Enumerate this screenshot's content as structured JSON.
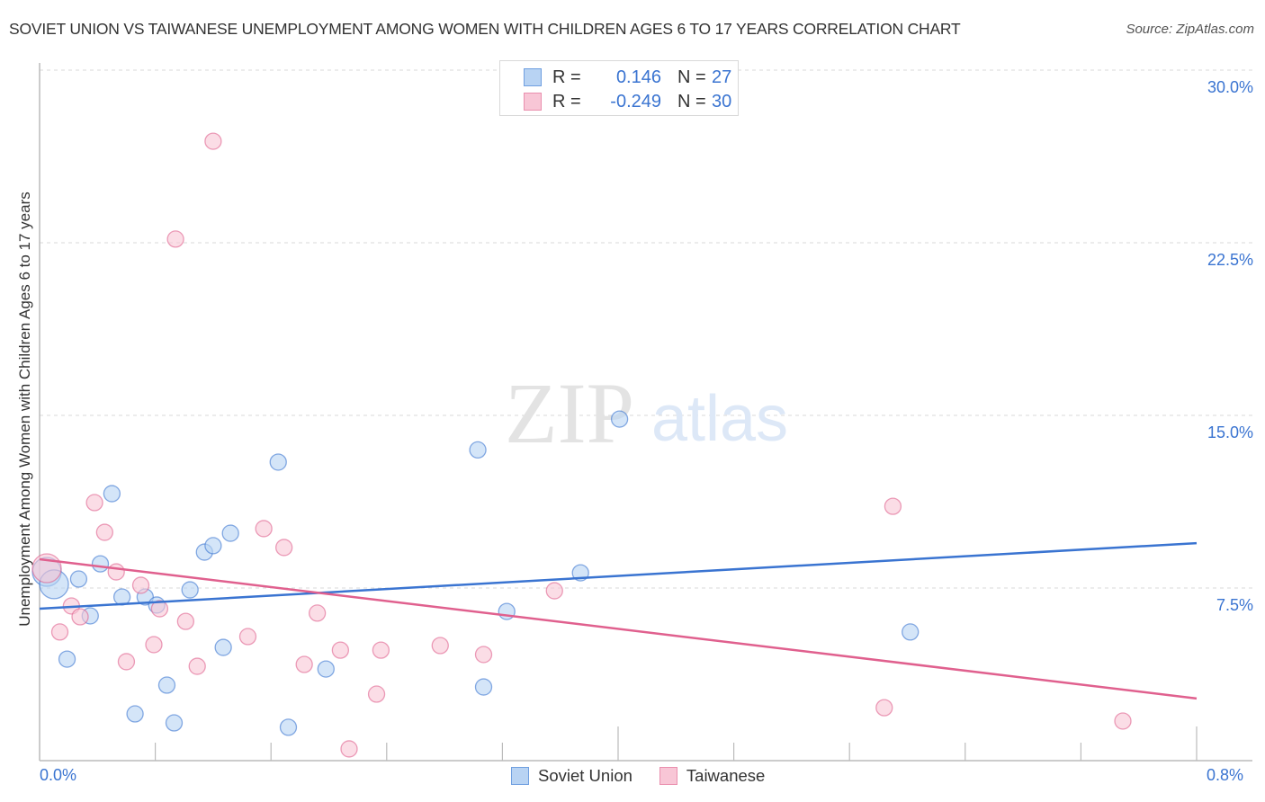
{
  "header": {
    "title": "SOVIET UNION VS TAIWANESE UNEMPLOYMENT AMONG WOMEN WITH CHILDREN AGES 6 TO 17 YEARS CORRELATION CHART",
    "source": "Source: ZipAtlas.com"
  },
  "watermark": {
    "zip": "ZIP",
    "atlas": "atlas"
  },
  "legend": {
    "rows": [
      {
        "series": "Soviet Union",
        "r_label": "R =",
        "r_value": "0.146",
        "n_label": "N =",
        "n_value": "27"
      },
      {
        "series": "Taiwanese",
        "r_label": "R =",
        "r_value": "-0.249",
        "n_label": "N =",
        "n_value": "30"
      }
    ]
  },
  "chart_data": {
    "type": "scatter",
    "title": "SOVIET UNION VS TAIWANESE UNEMPLOYMENT AMONG WOMEN WITH CHILDREN AGES 6 TO 17 YEARS CORRELATION CHART",
    "xlabel": "",
    "ylabel": "Unemployment Among Women with Children Ages 6 to 17 years",
    "xlim": [
      0,
      0.8
    ],
    "ylim": [
      0,
      30
    ],
    "x_tick_labels": [
      "0.0%",
      "0.8%"
    ],
    "y_ticks": [
      7.5,
      15.0,
      22.5,
      30.0
    ],
    "y_tick_labels": [
      "7.5%",
      "15.0%",
      "22.5%",
      "30.0%"
    ],
    "grid": true,
    "legend_position": "top-center",
    "bottom_legend": [
      "Soviet Union",
      "Taiwanese"
    ],
    "series": [
      {
        "name": "Soviet Union",
        "color": "#3a74d1",
        "fill": "#b8d3f3",
        "r": 0.146,
        "n": 27,
        "trend": {
          "x": [
            0,
            0.8
          ],
          "y": [
            6.6,
            9.45
          ]
        },
        "points": [
          {
            "x": 0.005,
            "y": 8.2,
            "big": true
          },
          {
            "x": 0.01,
            "y": 7.66,
            "big": true
          },
          {
            "x": 0.019,
            "y": 4.41
          },
          {
            "x": 0.027,
            "y": 7.89
          },
          {
            "x": 0.035,
            "y": 6.29
          },
          {
            "x": 0.042,
            "y": 8.55
          },
          {
            "x": 0.05,
            "y": 11.6
          },
          {
            "x": 0.057,
            "y": 7.11
          },
          {
            "x": 0.066,
            "y": 2.03
          },
          {
            "x": 0.073,
            "y": 7.11
          },
          {
            "x": 0.081,
            "y": 6.76
          },
          {
            "x": 0.088,
            "y": 3.28
          },
          {
            "x": 0.093,
            "y": 1.64
          },
          {
            "x": 0.104,
            "y": 7.42
          },
          {
            "x": 0.114,
            "y": 9.06
          },
          {
            "x": 0.12,
            "y": 9.34
          },
          {
            "x": 0.127,
            "y": 4.92
          },
          {
            "x": 0.132,
            "y": 9.88
          },
          {
            "x": 0.165,
            "y": 12.97
          },
          {
            "x": 0.172,
            "y": 1.45
          },
          {
            "x": 0.198,
            "y": 3.98
          },
          {
            "x": 0.303,
            "y": 13.5
          },
          {
            "x": 0.307,
            "y": 3.2
          },
          {
            "x": 0.323,
            "y": 6.48
          },
          {
            "x": 0.374,
            "y": 8.16
          },
          {
            "x": 0.401,
            "y": 14.84
          },
          {
            "x": 0.602,
            "y": 5.59
          }
        ]
      },
      {
        "name": "Taiwanese",
        "color": "#e0608e",
        "fill": "#f8c6d6",
        "r": -0.249,
        "n": 30,
        "trend": {
          "x": [
            0,
            0.8
          ],
          "y": [
            8.75,
            2.7
          ]
        },
        "points": [
          {
            "x": 0.005,
            "y": 8.36,
            "big": true
          },
          {
            "x": 0.014,
            "y": 5.59
          },
          {
            "x": 0.022,
            "y": 6.72
          },
          {
            "x": 0.028,
            "y": 6.25
          },
          {
            "x": 0.038,
            "y": 11.21
          },
          {
            "x": 0.045,
            "y": 9.92
          },
          {
            "x": 0.053,
            "y": 8.2
          },
          {
            "x": 0.06,
            "y": 4.3
          },
          {
            "x": 0.07,
            "y": 7.62
          },
          {
            "x": 0.079,
            "y": 5.04
          },
          {
            "x": 0.083,
            "y": 6.6
          },
          {
            "x": 0.094,
            "y": 22.66
          },
          {
            "x": 0.101,
            "y": 6.05
          },
          {
            "x": 0.109,
            "y": 4.1
          },
          {
            "x": 0.12,
            "y": 26.91
          },
          {
            "x": 0.144,
            "y": 5.39
          },
          {
            "x": 0.155,
            "y": 10.08
          },
          {
            "x": 0.169,
            "y": 9.26
          },
          {
            "x": 0.183,
            "y": 4.18
          },
          {
            "x": 0.192,
            "y": 6.41
          },
          {
            "x": 0.208,
            "y": 4.8
          },
          {
            "x": 0.214,
            "y": 0.51
          },
          {
            "x": 0.233,
            "y": 2.89
          },
          {
            "x": 0.236,
            "y": 4.8
          },
          {
            "x": 0.277,
            "y": 5.0
          },
          {
            "x": 0.307,
            "y": 4.61
          },
          {
            "x": 0.356,
            "y": 7.38
          },
          {
            "x": 0.59,
            "y": 11.05
          },
          {
            "x": 0.584,
            "y": 2.3
          },
          {
            "x": 0.749,
            "y": 1.72
          }
        ]
      }
    ]
  }
}
